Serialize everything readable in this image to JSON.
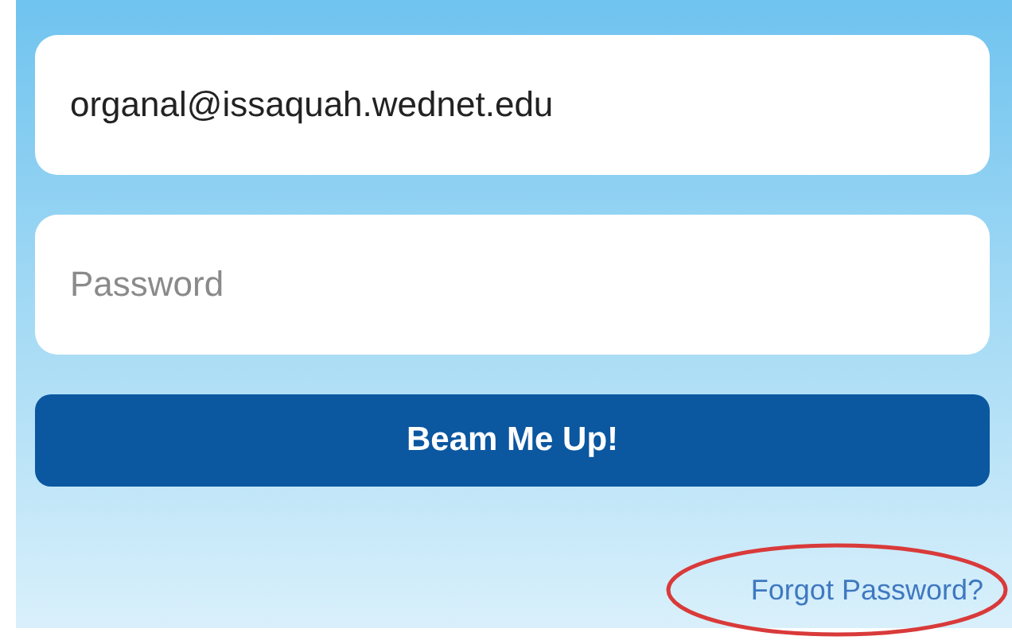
{
  "email_field": {
    "value": "organal@issaquah.wednet.edu"
  },
  "password_field": {
    "placeholder": "Password"
  },
  "submit_button": {
    "label": "Beam Me Up!"
  },
  "forgot_link": {
    "label": "Forgot Password?",
    "circled": true
  }
}
